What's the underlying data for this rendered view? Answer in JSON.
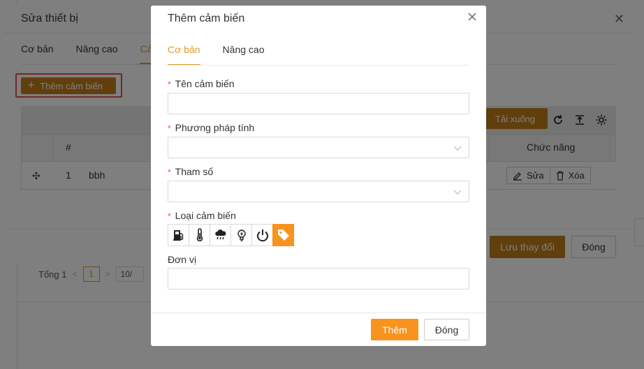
{
  "background_page": {
    "total_label": "Tổng 1",
    "current_page": "1",
    "page_size": "10/"
  },
  "outer_dialog": {
    "title": "Sửa thiết bị",
    "tabs": [
      {
        "label": "Cơ bản"
      },
      {
        "label": "Nâng cao"
      },
      {
        "label": "Cảm"
      }
    ],
    "add_sensor_label": "Thêm cảm biến",
    "download_label": "Tải xuống",
    "table": {
      "headers": {
        "index": "#",
        "functions": "Chức năng"
      },
      "rows": [
        {
          "index": "1",
          "name": "bbh",
          "edit_label": "Sửa",
          "delete_label": "Xóa"
        }
      ]
    },
    "save_label": "Lưu thay đổi",
    "close_label": "Đóng"
  },
  "inner_dialog": {
    "title": "Thêm cảm biến",
    "tabs": [
      {
        "label": "Cơ bản"
      },
      {
        "label": "Nâng cao"
      }
    ],
    "fields": {
      "sensor_name": {
        "label": "Tên cảm biến",
        "value": ""
      },
      "calc_method": {
        "label": "Phương pháp tính",
        "value": ""
      },
      "parameter": {
        "label": "Tham số",
        "value": ""
      },
      "sensor_type": {
        "label": "Loại cảm biến",
        "options": [
          "fuel-icon",
          "thermometer-icon",
          "rain-cloud-icon",
          "light-bulb-icon",
          "power-icon",
          "tag-icon"
        ],
        "selected": "tag-icon"
      },
      "unit": {
        "label": "Đơn vị",
        "value": ""
      }
    },
    "add_label": "Thêm",
    "close_label": "Đóng"
  },
  "colors": {
    "accent": "#f7931e",
    "accent_dim": "#c07f1b",
    "required": "#e0504e"
  }
}
